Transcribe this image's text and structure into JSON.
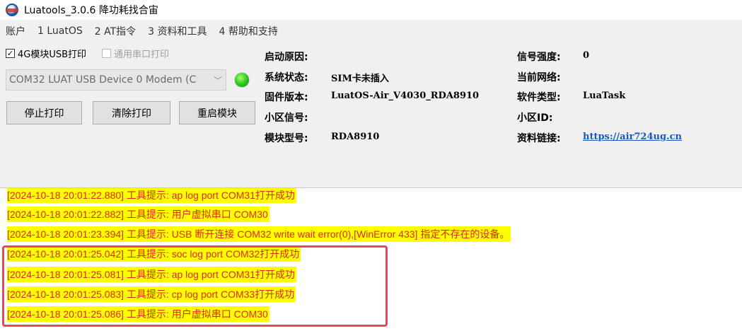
{
  "window": {
    "title": "Luatools_3.0.6 降功耗找合宙",
    "icon": "luatools-app-icon"
  },
  "menu": {
    "items": [
      "账户",
      "1 LuatOS",
      "2 AT指令",
      "3 资料和工具",
      "4 帮助和支持"
    ]
  },
  "controls": {
    "usb_print_label": "4G模块USB打印",
    "usb_print_checked": true,
    "serial_print_label": "通用串口打印",
    "serial_print_checked": false,
    "port_selected": "COM32 LUAT USB Device 0 Modem (C",
    "status_led_color": "#27c31a",
    "stop_print": "停止打印",
    "clear_print": "清除打印",
    "reboot_module": "重启模块"
  },
  "info": {
    "boot_reason_label": "启动原因:",
    "boot_reason_value": "",
    "system_status_label": "系统状态:",
    "system_status_value": "SIM卡未插入",
    "firmware_label": "固件版本:",
    "firmware_value": "LuatOS-Air_V4030_RDA8910",
    "cell_signal_label": "小区信号:",
    "cell_signal_value": "",
    "module_model_label": "模块型号:",
    "module_model_value": "RDA8910",
    "signal_strength_label": "信号强度:",
    "signal_strength_value": "0",
    "current_network_label": "当前网络:",
    "current_network_value": "",
    "software_type_label": "软件类型:",
    "software_type_value": "LuaTask",
    "cell_id_label": "小区ID:",
    "cell_id_value": "",
    "docs_link_label": "资料链接:",
    "docs_link_value": "https://air724ug.cn"
  },
  "log": {
    "text_color": "#e0280c",
    "highlight_color": "#ffff00",
    "lines": [
      "[2024-10-18 20:01:22.880] 工具提示: ap log port COM31打开成功",
      "[2024-10-18 20:01:22.882] 工具提示: 用户虚拟串口 COM30",
      "[2024-10-18 20:01:23.394] 工具提示: USB 断开连接 COM32 write wait error(0),[WinError 433] 指定不存在的设备。",
      "[2024-10-18 20:01:25.042] 工具提示: soc log port COM32打开成功",
      "[2024-10-18 20:01:25.081] 工具提示: ap log port COM31打开成功",
      "[2024-10-18 20:01:25.083] 工具提示: cp log port COM33打开成功",
      "[2024-10-18 20:01:25.086] 工具提示: 用户虚拟串口 COM30"
    ]
  }
}
